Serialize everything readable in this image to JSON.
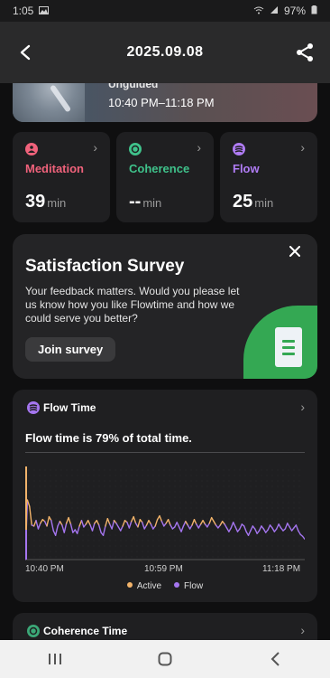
{
  "status": {
    "time": "1:05",
    "battery": "97%"
  },
  "header": {
    "title": "2025.09.08"
  },
  "session": {
    "type": "Unguided",
    "time_range": "10:40 PM–11:18 PM"
  },
  "metrics": [
    {
      "label": "Meditation",
      "value": "39",
      "unit": "min",
      "color": "#f0627b"
    },
    {
      "label": "Coherence",
      "value": "--",
      "unit": "min",
      "color": "#3fc28b"
    },
    {
      "label": "Flow",
      "value": "25",
      "unit": "min",
      "color": "#b07cf5"
    }
  ],
  "survey": {
    "title": "Satisfaction Survey",
    "text": "Your feedback matters. Would you please let us know how you like Flowtime and how we could serve you better?",
    "button": "Join survey"
  },
  "flow_card": {
    "title": "Flow Time",
    "summary": "Flow time is 79% of total time.",
    "x_labels": [
      "10:40 PM",
      "10:59 PM",
      "11:18 PM"
    ],
    "legend": [
      {
        "label": "Active",
        "color": "#f2b36a"
      },
      {
        "label": "Flow",
        "color": "#a576f0"
      }
    ]
  },
  "chart_data": {
    "type": "line",
    "x": [
      "10:40 PM",
      "10:59 PM",
      "11:18 PM"
    ],
    "series": [
      {
        "name": "Active",
        "color": "#f2b36a",
        "values": [
          0.0,
          0.64,
          0.57,
          0.37,
          0.36,
          0.42,
          0.33,
          0.39,
          0.43,
          0.41,
          0.36,
          0.46,
          0.42,
          0.31,
          0.26,
          0.36,
          0.41,
          0.37,
          0.29,
          0.39,
          0.45,
          0.38,
          0.29,
          0.32,
          0.28,
          0.36,
          0.42,
          0.35,
          0.38,
          0.42,
          0.37,
          0.31,
          0.39,
          0.42,
          0.37,
          0.29,
          0.26,
          0.36,
          0.44,
          0.38,
          0.33,
          0.42,
          0.39,
          0.35,
          0.31,
          0.36,
          0.42,
          0.4,
          0.34,
          0.41,
          0.46,
          0.39,
          0.35,
          0.43,
          0.4,
          0.33,
          0.37,
          0.42,
          0.38,
          0.33,
          0.36,
          0.43,
          0.47,
          0.41,
          0.36,
          0.39,
          0.43,
          0.37,
          0.33,
          0.35,
          0.4,
          0.35,
          0.3,
          0.36,
          0.41,
          0.37,
          0.33,
          0.37,
          0.43,
          0.38,
          0.34,
          0.38,
          0.42,
          0.38,
          0.35,
          0.39,
          0.45,
          0.41,
          0.37,
          0.34,
          0.37,
          0.41,
          0.38,
          0.34,
          0.3,
          0.34,
          0.4,
          0.35,
          0.3,
          0.33,
          0.38,
          0.36,
          0.3,
          0.26,
          0.31,
          0.36,
          0.33,
          0.28,
          0.31,
          0.36,
          0.33,
          0.29,
          0.32,
          0.37,
          0.34,
          0.3,
          0.33,
          0.38,
          0.34,
          0.31,
          0.33,
          0.39,
          0.35,
          0.31,
          0.34,
          0.37,
          0.31,
          0.27,
          0.25,
          0.22
        ]
      }
    ],
    "events": [
      {
        "time": "10:40 PM",
        "color": "#f2b36a"
      },
      {
        "time": "10:40 PM",
        "color": "#a576f0"
      }
    ]
  },
  "coherence_card": {
    "title": "Coherence Time"
  }
}
